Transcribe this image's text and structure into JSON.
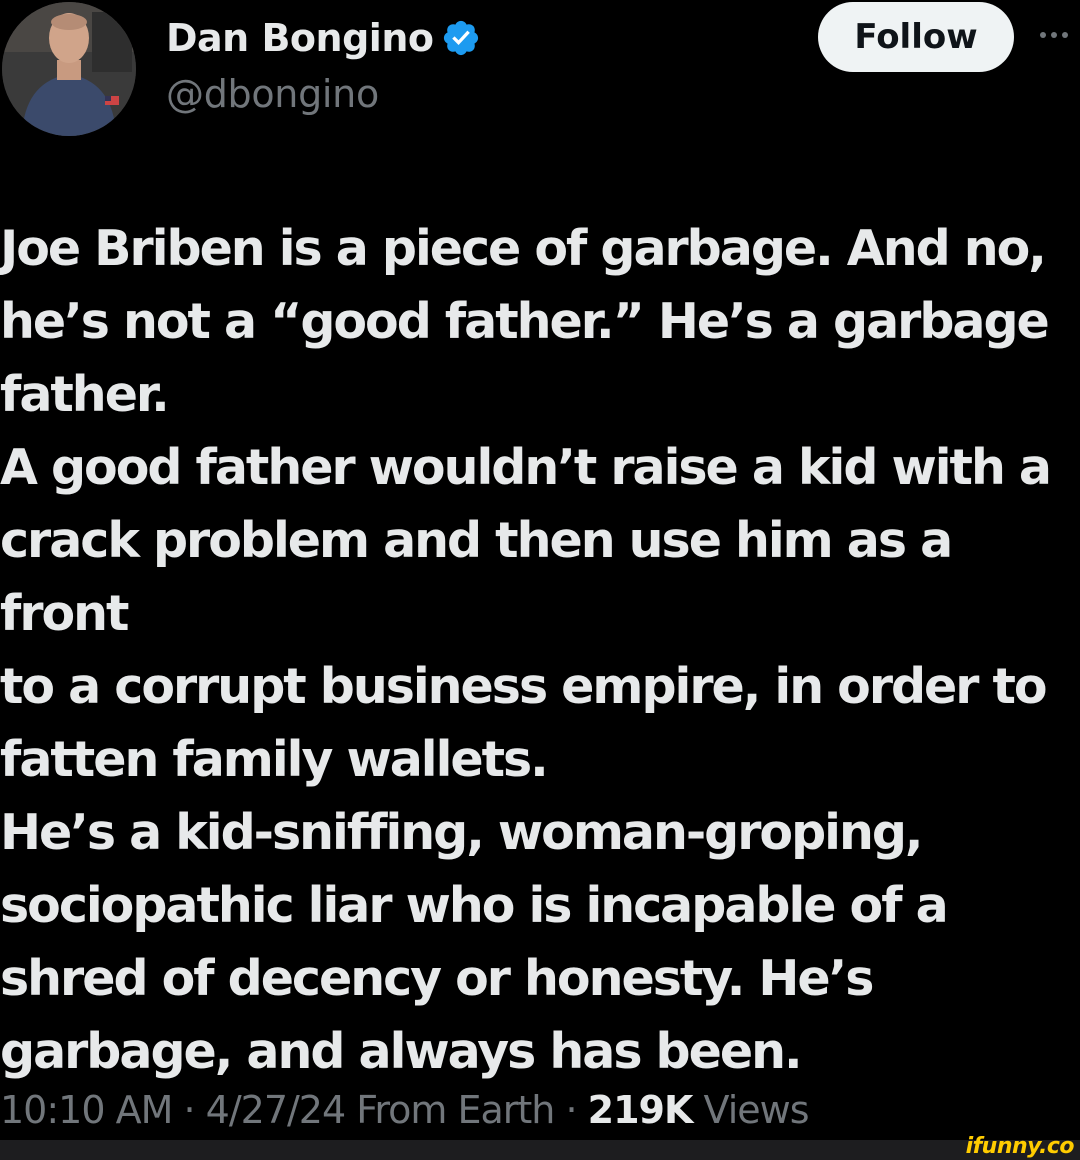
{
  "author": {
    "display_name": "Dan Bongino",
    "handle": "@dbongino",
    "verified_icon": "verified-badge-icon",
    "avatar_icon": "avatar-photo"
  },
  "actions": {
    "follow_label": "Follow",
    "more_icon": "more-options-icon"
  },
  "tweet": {
    "text": "Joe Briben is a piece of garbage. And no,\nhe’s not a “good father.” He’s a garbage\nfather.\nA good father wouldn’t raise a kid with a\ncrack problem and then use him as a front\nto a corrupt business empire, in order to\nfatten family wallets.\nHe’s a kid-sniffing, woman-groping,\nsociopathic liar who is incapable of a\nshred of decency or honesty. He’s\ngarbage, and always has been."
  },
  "meta": {
    "time": "10:10 AM",
    "separator": "·",
    "date": "4/27/24",
    "source": "From Earth",
    "views_count": "219K",
    "views_label": "Views"
  },
  "watermark": {
    "text": "ifunny.co"
  },
  "colors": {
    "background": "#000000",
    "primary_text": "#e7e9ea",
    "secondary_text": "#71767b",
    "verified_blue": "#1d9bf0",
    "follow_bg": "#eff3f4",
    "watermark": "#ffcc00"
  }
}
